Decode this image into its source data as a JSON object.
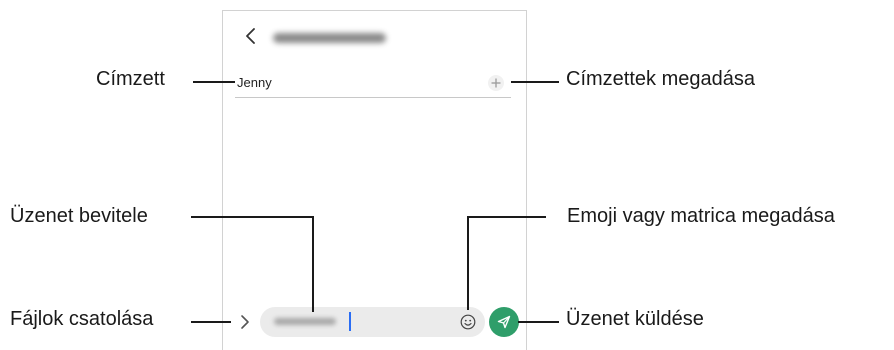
{
  "panel": {
    "recipient": "Jenny"
  },
  "callouts": {
    "recipient": "Címzett",
    "add_recipients": "Címzettek megadása",
    "enter_message": "Üzenet bevitele",
    "emoji_sticker": "Emoji vagy matrica megadása",
    "attach_files": "Fájlok csatolása",
    "send_message": "Üzenet küldése"
  },
  "colors": {
    "send_button": "#2f9e6a",
    "caret": "#2a6df4",
    "field_bg": "#ebebeb"
  },
  "icons": [
    "back-icon",
    "add-icon",
    "attach-icon",
    "emoji-icon",
    "send-icon"
  ]
}
